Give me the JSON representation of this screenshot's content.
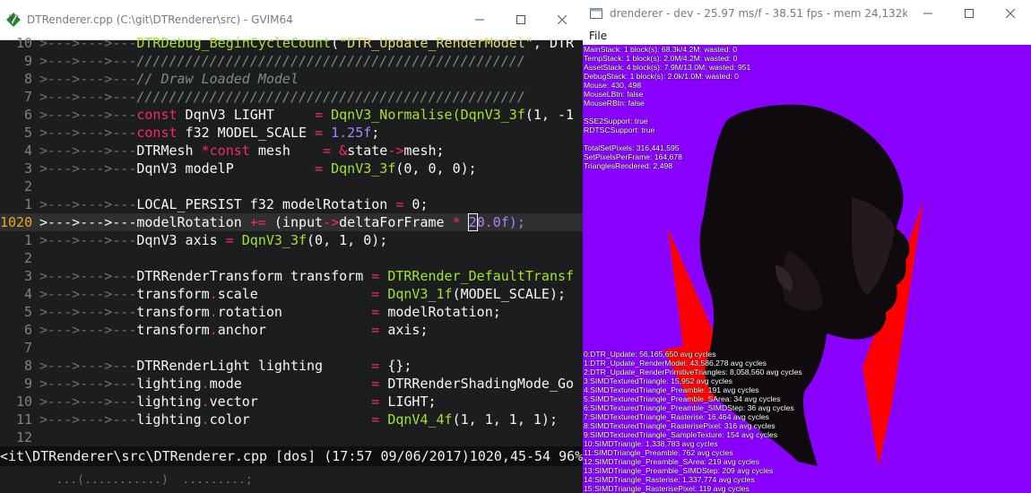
{
  "gvim": {
    "title": "DTRenderer.cpp (C:\\git\\DTRenderer\\src) - GVIM64",
    "status_line": "<it\\DTRenderer\\src\\DTRenderer.cpp [dos] (17:57 09/06/2017)1020,45-54 96%",
    "cmdline_text": "        ...(...........)  .........;",
    "lines": {
      "l0": {
        "num": "10"
      },
      "l1": {
        "num": "9"
      },
      "l2": {
        "num": "8"
      },
      "l3": {
        "num": "7"
      },
      "l4": {
        "num": "6"
      },
      "l5": {
        "num": "5"
      },
      "l6": {
        "num": "4"
      },
      "l7": {
        "num": "3"
      },
      "l8": {
        "num": "2"
      },
      "l9": {
        "num": "1"
      },
      "l10": {
        "num": "1020"
      },
      "l11": {
        "num": "1"
      },
      "l12": {
        "num": "2"
      },
      "l13": {
        "num": "3"
      },
      "l14": {
        "num": "4"
      },
      "l15": {
        "num": "5"
      },
      "l16": {
        "num": "6"
      },
      "l17": {
        "num": "7"
      },
      "l18": {
        "num": "8"
      },
      "l19": {
        "num": "9"
      },
      "l20": {
        "num": "10"
      },
      "l21": {
        "num": "11"
      },
      "l22": {
        "num": "12"
      }
    },
    "code": {
      "arrow2": ">--->--->---",
      "arrow1": ">--->---",
      "l0_fn": "DTRDebug_BeginCycleCount",
      "l0_str": "\"DTR_Update_RenderModel\"",
      "l0_rest": ", DTR",
      "l1_cm": "////////////////////////////////////////////////",
      "l2_cm": "// Draw Loaded Model",
      "l3_cm": "////////////////////////////////////////////////",
      "l4_kw": "const",
      "l4_mid": " DqnV3 LIGHT     ",
      "l4_eq": "=",
      "l4_fn": "DqnV3_Normalise(DqnV3_3f",
      "l4_rest": "(1, -1",
      "l5_kw": "const",
      "l5_mid": " f32 MODEL_SCALE ",
      "l5_eq": "=",
      "l5_num": "1.25f",
      "l6_a": "DTRMesh ",
      "l6_kw": "*const",
      "l6_b": " mesh    ",
      "l6_eq": "=",
      "l6_amp": "&",
      "l6_c": "state",
      "l6_arrow": "->",
      "l6_d": "mesh;",
      "l7_a": "DqnV3 modelP          ",
      "l7_eq": "=",
      "l7_fn": "DqnV3_3f",
      "l7_b": "(0, 0, 0);",
      "l9_a": "LOCAL_PERSIST f32 modelRotation ",
      "l9_eq": "=",
      "l9_b": " 0;",
      "l10_a": "modelRotation ",
      "l10_op": "+=",
      "l10_b": " (input",
      "l10_arrow": "->",
      "l10_c": "deltaForFrame ",
      "l10_mul": "*",
      "l10_sp": " ",
      "l10_cur": "2",
      "l10_d": "0.0f);",
      "l11_a": "DqnV3 axis ",
      "l11_eq": "=",
      "l11_fn": "DqnV3_3f",
      "l11_b": "(0, 1, 0);",
      "l13_a": "DTRRenderTransform transform ",
      "l13_eq": "=",
      "l13_fn": "DTRRender_DefaultTransf",
      "l14_a": "transform",
      "l14_dot": ".",
      "l14_b": "scale              ",
      "l14_eq": "=",
      "l14_fn": "DqnV3_1f",
      "l14_c": "(MODEL_SCALE);",
      "l15_a": "transform",
      "l15_dot": ".",
      "l15_b": "rotation           ",
      "l15_eq": "=",
      "l15_c": " modelRotation;",
      "l16_a": "transform",
      "l16_dot": ".",
      "l16_b": "anchor             ",
      "l16_eq": "=",
      "l16_c": " axis;",
      "l18_a": "DTRRenderLight lighting      ",
      "l18_eq": "=",
      "l18_c": " {};",
      "l19_a": "lighting",
      "l19_dot": ".",
      "l19_b": "mode                ",
      "l19_eq": "=",
      "l19_c": " DTRRenderShadingMode_Go",
      "l20_a": "lighting",
      "l20_dot": ".",
      "l20_b": "vector              ",
      "l20_eq": "=",
      "l20_c": " LIGHT;",
      "l21_a": "lighting",
      "l21_dot": ".",
      "l21_b": "color               ",
      "l21_eq": "=",
      "l21_fn": "DqnV4_4f",
      "l21_c": "(1, 1, 1, 1);"
    }
  },
  "renderer": {
    "title": "drenderer - dev - 25.97 ms/f - 38.51 fps - mem 24,132kb",
    "menu_file": "File",
    "background_color": "#8a00ff",
    "stats_top": [
      "MainStack: 1 block(s): 68.3k/4.2M: wasted: 0",
      "TempStack: 1 block(s): 2.0M/4.2M: wasted: 0",
      "AssetStack: 4 block(s): 7.9M/13.0M: wasted: 951",
      "DebugStack: 1 block(s): 2.0k/1.0M: wasted: 0",
      "Mouse: 430, 498",
      "MouseLBtn: false",
      "MouseRBtn: false",
      "",
      "SSE2Support: true",
      "RDTSCSupport: true",
      "",
      "TotalSetPixels: 316,441,595",
      "SetPixelsPerFrame: 164,678",
      "TrianglesRendered: 2,498"
    ],
    "stats_bottom": [
      "0:DTR_Update: 56,165,650 avg cycles",
      "1:DTR_Update_RenderModel: 43,586,278 avg cycles",
      "2:DTR_Update_RenderPrimitiveTriangles: 8,058,560 avg cycles",
      "3:SIMDTexturedTriangle: 15,952 avg cycles",
      "4:SIMDTexturedTriangle_Preamble: 191 avg cycles",
      "5:SIMDTexturedTriangle_Preamble_SArea: 34 avg cycles",
      "6:SIMDTexturedTriangle_Preamble_SIMDStep: 36 avg cycles",
      "7:SIMDTexturedTriangle_Rasterise: 16,464 avg cycles",
      "8:SIMDTexturedTriangle_RasterisePixel: 316 avg cycles",
      "9:SIMDTexturedTriangle_SampleTexture: 154 avg cycles",
      "10:SIMDTriangle: 1,338,783 avg cycles",
      "11:SIMDTriangle_Preamble: 762 avg cycles",
      "12:SIMDTriangle_Preamble_SArea: 219 avg cycles",
      "13:SIMDTriangle_Preamble_SIMDStep: 209 avg cycles",
      "14:SIMDTriangle_Rasterise: 1,337,774 avg cycles",
      "15:SIMDTriangle_RasterisePixel: 119 avg cycles"
    ]
  }
}
